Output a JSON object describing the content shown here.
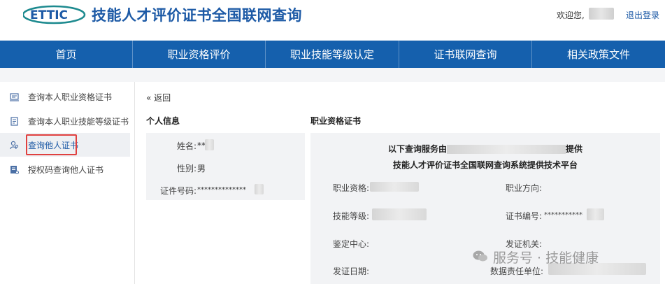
{
  "header": {
    "logo_text": "ETTIC",
    "title": "技能人才评价证书全国联网查询",
    "welcome": "欢迎您,",
    "logout": "退出登录"
  },
  "nav": {
    "items": [
      {
        "label": "首页"
      },
      {
        "label": "职业资格评价"
      },
      {
        "label": "职业技能等级认定"
      },
      {
        "label": "证书联网查询"
      },
      {
        "label": "相关政策文件"
      }
    ]
  },
  "sidebar": {
    "items": [
      {
        "label": "查询本人职业资格证书",
        "icon": "certificate-icon"
      },
      {
        "label": "查询本人职业技能等级证书",
        "icon": "document-icon"
      },
      {
        "label": "查询他人证书",
        "icon": "user-search-icon",
        "active": true
      },
      {
        "label": "授权码查询他人证书",
        "icon": "key-document-icon"
      }
    ]
  },
  "main": {
    "back": "« 返回",
    "personal": {
      "title": "个人信息",
      "name_label": "姓名:",
      "name_value": "**",
      "gender_label": "性别:",
      "gender_value": "男",
      "id_label": "证件号码:",
      "id_value": "**************"
    },
    "cert": {
      "title": "职业资格证书",
      "notice_line1_a": "以下查询服务由",
      "notice_line1_b": "提供",
      "notice_line2": "技能人才评价证书全国联网查询系统提供技术平台",
      "qualification_label": "职业资格:",
      "direction_label": "职业方向:",
      "level_label": "技能等级:",
      "cert_no_label": "证书编号:",
      "cert_no_value": "***********",
      "center_label": "鉴定中心:",
      "issuer_label": "发证机关:",
      "issue_date_label": "发证日期:",
      "data_unit_label": "数据责任单位:"
    }
  },
  "watermark": {
    "text": "服务号 · 技能健康"
  }
}
